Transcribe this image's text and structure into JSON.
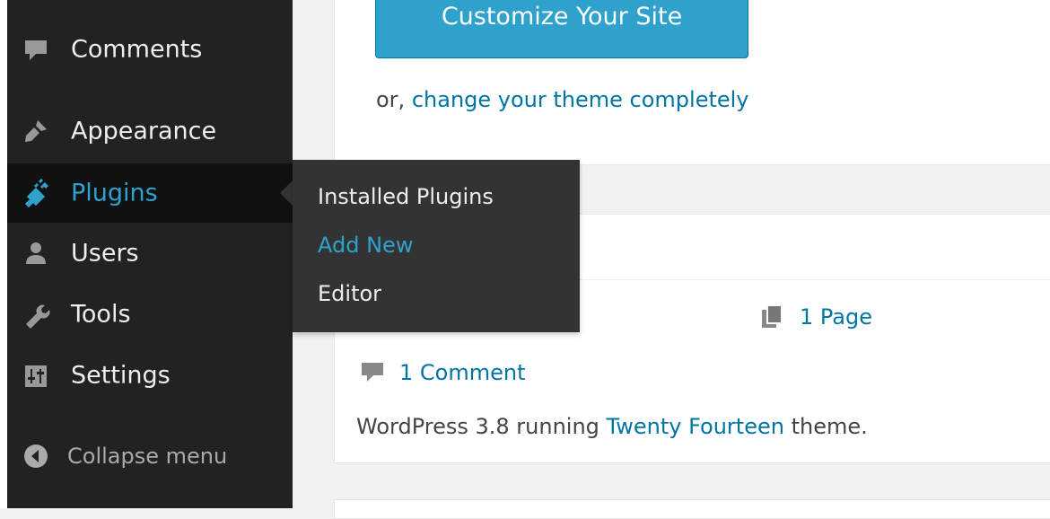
{
  "sidebar": {
    "items": [
      {
        "label": "Comments",
        "icon": "comment-icon"
      },
      {
        "label": "Appearance",
        "icon": "paintbrush-icon"
      },
      {
        "label": "Plugins",
        "icon": "plug-icon"
      },
      {
        "label": "Users",
        "icon": "user-icon"
      },
      {
        "label": "Tools",
        "icon": "wrench-icon"
      },
      {
        "label": "Settings",
        "icon": "settings-icon"
      }
    ],
    "collapse_label": "Collapse menu"
  },
  "flyout": {
    "items": [
      {
        "label": "Installed Plugins"
      },
      {
        "label": "Add New"
      },
      {
        "label": "Editor"
      }
    ]
  },
  "welcome": {
    "customize_label": "Customize Your Site",
    "or_text": "or,",
    "change_theme_link": "change your theme completely"
  },
  "right_now": {
    "pages": "1 Page",
    "comments": "1 Comment",
    "version_prefix": "WordPress 3.8 running",
    "theme_link": "Twenty Fourteen",
    "version_suffix": "theme."
  },
  "colors": {
    "sidebar_bg": "#222222",
    "active_bg": "#111111",
    "accent": "#2ea2cc",
    "link": "#0074a2",
    "text": "#444444",
    "icon": "#999999"
  }
}
